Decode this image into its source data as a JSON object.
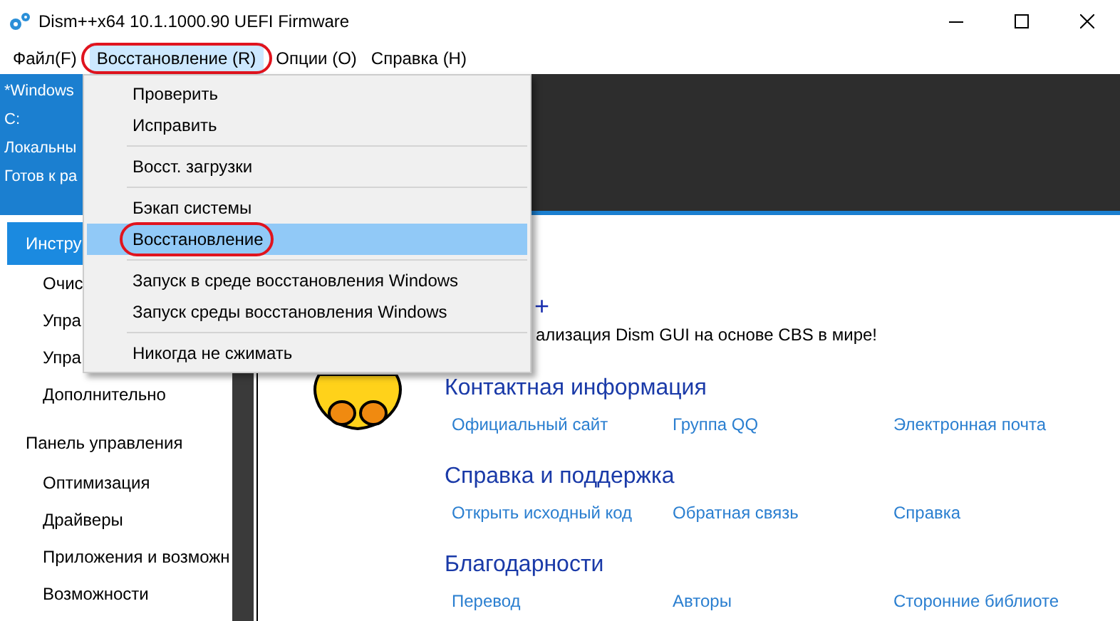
{
  "window": {
    "title": "Dism++x64 10.1.1000.90 UEFI Firmware"
  },
  "menu_bar": [
    {
      "label": "Файл(F)",
      "selected": false,
      "circled": false
    },
    {
      "label": "Восстановление (R)",
      "selected": true,
      "circled": true
    },
    {
      "label": "Опции (O)",
      "selected": false,
      "circled": false
    },
    {
      "label": "Справка (H)",
      "selected": false,
      "circled": false
    }
  ],
  "dropdown": {
    "groups": [
      [
        {
          "label": "Проверить",
          "selected": false,
          "circled": false
        },
        {
          "label": "Исправить",
          "selected": false,
          "circled": false
        }
      ],
      [
        {
          "label": "Восст. загрузки",
          "selected": false,
          "circled": false
        }
      ],
      [
        {
          "label": "Бэкап системы",
          "selected": false,
          "circled": false
        },
        {
          "label": "Восстановление",
          "selected": true,
          "circled": true
        }
      ],
      [
        {
          "label": "Запуск в среде восстановления Windows",
          "selected": false,
          "circled": false
        },
        {
          "label": "Запуск среды восстановления Windows",
          "selected": false,
          "circled": false
        }
      ],
      [
        {
          "label": "Никогда не сжимать",
          "selected": false,
          "circled": false
        }
      ]
    ]
  },
  "session_info": [
    "*Windows",
    "C:",
    "Локальны",
    "Готов к ра"
  ],
  "sidebar": {
    "items": [
      {
        "label": "Инстру",
        "selected": true,
        "children": [
          {
            "label": "Очис",
            "selected": false
          },
          {
            "label": "Упра",
            "selected": false
          },
          {
            "label": "Упра",
            "selected": false
          },
          {
            "label": "Дополнительно",
            "selected": false
          }
        ]
      },
      {
        "label": "Панель управления",
        "selected": false,
        "children": [
          {
            "label": "Оптимизация",
            "selected": false
          },
          {
            "label": "Драйверы",
            "selected": false
          },
          {
            "label": "Приложения и возможн",
            "selected": false
          },
          {
            "label": "Возможности",
            "selected": false
          }
        ]
      }
    ]
  },
  "about": {
    "title": "+",
    "subtitle": "ализация Dism GUI на основе CBS в мире!",
    "sections": [
      {
        "heading": "Контактная информация",
        "links": [
          "Официальный сайт",
          "Группа QQ",
          "Электронная почта"
        ]
      },
      {
        "heading": "Справка и поддержка",
        "links": [
          "Открыть исходный код",
          "Обратная связь",
          "Справка"
        ]
      },
      {
        "heading": "Благодарности",
        "links": [
          "Перевод",
          "Авторы",
          "Сторонние библиоте"
        ]
      }
    ]
  }
}
